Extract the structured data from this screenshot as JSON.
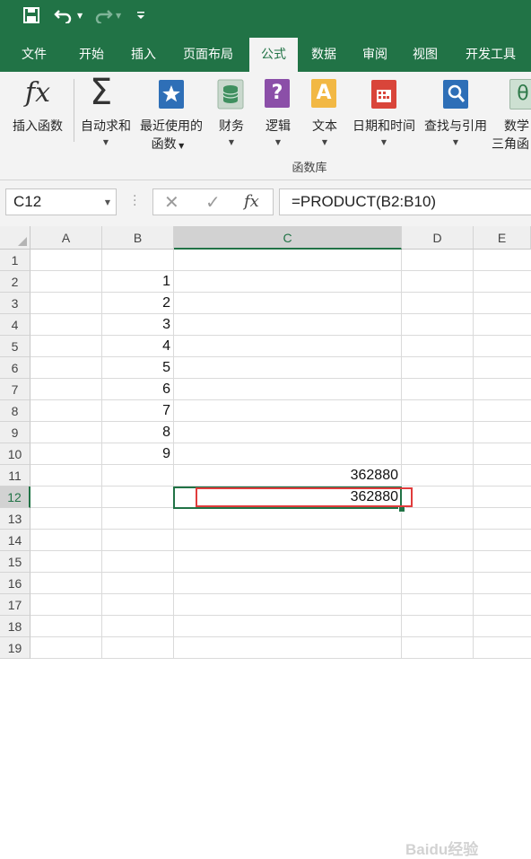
{
  "qat": {
    "save_icon": "save-icon",
    "undo_icon": "undo-icon",
    "redo_icon": "redo-icon",
    "customize_icon": "customize-qat-icon"
  },
  "tabs": [
    {
      "label": "文件"
    },
    {
      "label": "开始"
    },
    {
      "label": "插入"
    },
    {
      "label": "页面布局"
    },
    {
      "label": "公式"
    },
    {
      "label": "数据"
    },
    {
      "label": "审阅"
    },
    {
      "label": "视图"
    },
    {
      "label": "开发工具"
    }
  ],
  "ribbon": {
    "insert_function": {
      "label": "插入函数",
      "icon_glyph": "fx"
    },
    "autosum": {
      "label": "自动求和",
      "icon_glyph": "Σ"
    },
    "recent": {
      "label1": "最近使用的",
      "label2": "函数"
    },
    "financial": {
      "label": "财务"
    },
    "logical": {
      "label": "逻辑",
      "icon_glyph": "?"
    },
    "text": {
      "label": "文本",
      "icon_glyph": "A"
    },
    "datetime": {
      "label": "日期和时间"
    },
    "lookup": {
      "label": "查找与引用"
    },
    "math": {
      "label1": "数学",
      "label2": "三角函",
      "icon_glyph": "θ"
    },
    "group_label": "函数库"
  },
  "formula_bar": {
    "name_box": "C12",
    "cancel_glyph": "✕",
    "enter_glyph": "✓",
    "fx_glyph": "fx",
    "formula": "=PRODUCT(B2:B10)"
  },
  "columns": [
    "A",
    "B",
    "C",
    "D",
    "E"
  ],
  "rows": [
    "1",
    "2",
    "3",
    "4",
    "5",
    "6",
    "7",
    "8",
    "9",
    "10",
    "11",
    "12",
    "13",
    "14",
    "15",
    "16",
    "17",
    "18",
    "19"
  ],
  "cells": {
    "B2": "1",
    "B3": "2",
    "B4": "3",
    "B5": "4",
    "B6": "5",
    "B7": "6",
    "B8": "7",
    "B9": "8",
    "B10": "9",
    "C11": "362880",
    "C12": "362880"
  },
  "selection": {
    "column": "C",
    "row": "12"
  },
  "colors": {
    "accent": "#217346",
    "highlight_box": "#e03c3c"
  },
  "watermark": "Baidu经验"
}
